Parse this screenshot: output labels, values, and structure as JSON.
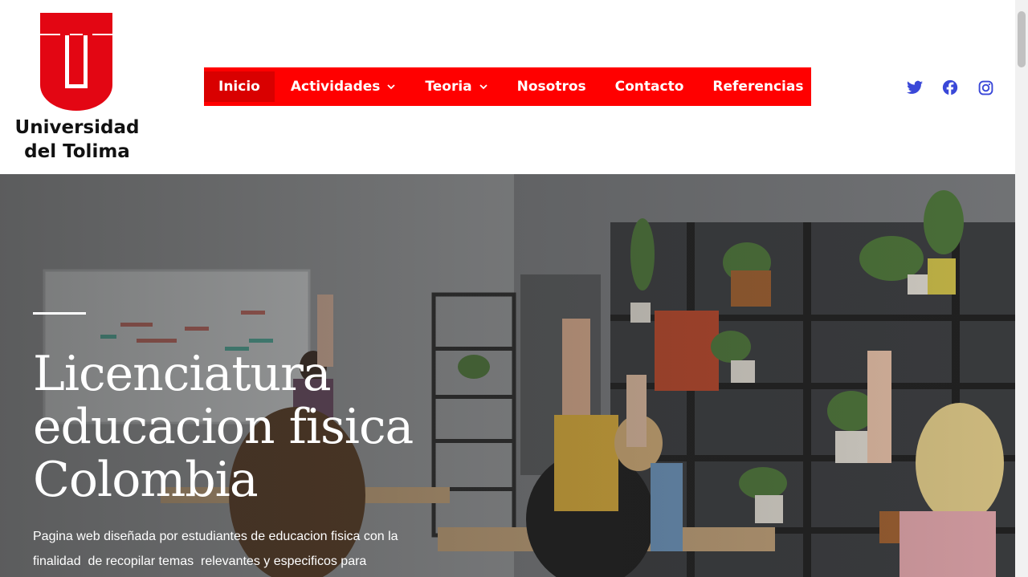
{
  "brand": {
    "name_line1": "Universidad",
    "name_line2": "del Tolima",
    "color": "#e30613"
  },
  "nav": {
    "background": "#ff0000",
    "items": [
      {
        "label": "Inicio",
        "active": true,
        "has_dropdown": false
      },
      {
        "label": "Actividades",
        "active": false,
        "has_dropdown": true
      },
      {
        "label": "Teoria",
        "active": false,
        "has_dropdown": true
      },
      {
        "label": "Nosotros",
        "active": false,
        "has_dropdown": false
      },
      {
        "label": "Contacto",
        "active": false,
        "has_dropdown": false
      },
      {
        "label": "Referencias",
        "active": false,
        "has_dropdown": false
      }
    ]
  },
  "socials": {
    "color": "#3a48d8",
    "icons": [
      "twitter-icon",
      "facebook-icon",
      "instagram-icon"
    ]
  },
  "hero": {
    "title_line1": "Licenciatura",
    "title_line2": "educacion fisica",
    "title_line3": "Colombia",
    "desc_line1": "Pagina web diseñada por estudiantes de educacion fisica con la",
    "desc_line2": "finalidad  de recopilar temas  relevantes y especificos para"
  }
}
